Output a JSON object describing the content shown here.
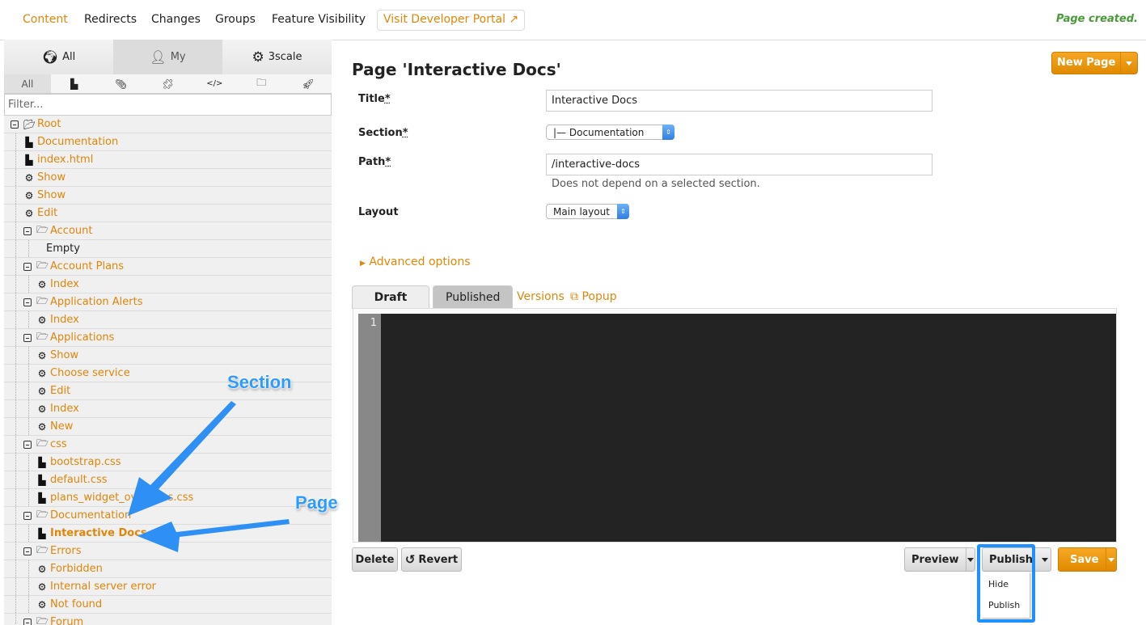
{
  "topnav": {
    "items": [
      "Content",
      "Redirects",
      "Changes",
      "Groups",
      "Feature Visibility"
    ],
    "active": "Content",
    "portal_link": "Visit Developer Portal",
    "flash": "Page created."
  },
  "sidebar": {
    "scope_tabs": [
      {
        "label": "All",
        "icon": "globe-icon"
      },
      {
        "label": "My",
        "icon": "user-icon"
      },
      {
        "label": "3scale",
        "icon": "gear-icon"
      }
    ],
    "active_scope": "My",
    "type_tabs": [
      {
        "label": "All",
        "icon": ""
      },
      {
        "label": "",
        "icon": "file-icon"
      },
      {
        "label": "",
        "icon": "paperclip-icon"
      },
      {
        "label": "",
        "icon": "puzzle-icon"
      },
      {
        "label": "",
        "icon": "code-icon"
      },
      {
        "label": "",
        "icon": "folder-icon"
      },
      {
        "label": "",
        "icon": "rocket-icon"
      }
    ],
    "filter_placeholder": "Filter...",
    "tree": [
      {
        "label": "Root",
        "type": "folder-open",
        "level": 0,
        "toggle": true
      },
      {
        "label": "Documentation",
        "type": "file",
        "level": 1
      },
      {
        "label": "index.html",
        "type": "file",
        "level": 1
      },
      {
        "label": "Show",
        "type": "gear",
        "level": 1
      },
      {
        "label": "Show",
        "type": "gear",
        "level": 1
      },
      {
        "label": "Edit",
        "type": "gear",
        "level": 1
      },
      {
        "label": "Account",
        "type": "folder",
        "level": 1,
        "toggle": true
      },
      {
        "label": "Empty",
        "type": "empty",
        "level": 2
      },
      {
        "label": "Account Plans",
        "type": "folder",
        "level": 1,
        "toggle": true
      },
      {
        "label": "Index",
        "type": "gear",
        "level": 2
      },
      {
        "label": "Application Alerts",
        "type": "folder",
        "level": 1,
        "toggle": true
      },
      {
        "label": "Index",
        "type": "gear",
        "level": 2
      },
      {
        "label": "Applications",
        "type": "folder",
        "level": 1,
        "toggle": true
      },
      {
        "label": "Show",
        "type": "gear",
        "level": 2
      },
      {
        "label": "Choose service",
        "type": "gear",
        "level": 2
      },
      {
        "label": "Edit",
        "type": "gear",
        "level": 2
      },
      {
        "label": "Index",
        "type": "gear",
        "level": 2
      },
      {
        "label": "New",
        "type": "gear",
        "level": 2
      },
      {
        "label": "css",
        "type": "folder",
        "level": 1,
        "toggle": true
      },
      {
        "label": "bootstrap.css",
        "type": "file",
        "level": 2
      },
      {
        "label": "default.css",
        "type": "file",
        "level": 2
      },
      {
        "label": "plans_widget_overrides.css",
        "type": "file",
        "level": 2
      },
      {
        "label": "Documentation",
        "type": "folder",
        "level": 1,
        "toggle": true
      },
      {
        "label": "Interactive Docs",
        "type": "file",
        "level": 2,
        "selected": true
      },
      {
        "label": "Errors",
        "type": "folder",
        "level": 1,
        "toggle": true
      },
      {
        "label": "Forbidden",
        "type": "gear",
        "level": 2
      },
      {
        "label": "Internal server error",
        "type": "gear",
        "level": 2
      },
      {
        "label": "Not found",
        "type": "gear",
        "level": 2
      },
      {
        "label": "Forum",
        "type": "folder",
        "level": 1,
        "toggle": true
      }
    ]
  },
  "main": {
    "title": "Page 'Interactive Docs'",
    "new_page_label": "New Page",
    "form": {
      "title_label": "Title",
      "title_value": "Interactive Docs",
      "section_label": "Section",
      "section_value": "|— Documentation",
      "path_label": "Path",
      "path_value": "/interactive-docs",
      "path_hint": "Does not depend on a selected section.",
      "layout_label": "Layout",
      "layout_value": "Main layout",
      "required_mark": "*"
    },
    "advanced_options": "Advanced options",
    "editor_tabs": {
      "draft": "Draft",
      "published": "Published",
      "versions": "Versions",
      "popup": "Popup"
    },
    "editor": {
      "line_numbers": [
        "1"
      ]
    },
    "buttons": {
      "delete": "Delete",
      "revert": "Revert",
      "preview": "Preview",
      "publish": "Publish",
      "save": "Save"
    },
    "publish_menu": [
      "Hide",
      "Publish"
    ]
  },
  "annotations": {
    "section": "Section",
    "page": "Page",
    "color": "#2e9bff"
  }
}
